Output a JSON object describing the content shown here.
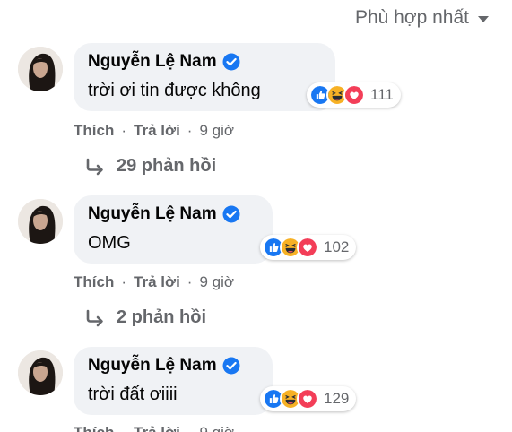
{
  "sort": {
    "label": "Phù hợp nhất"
  },
  "colors": {
    "like_blue": "#1877f2",
    "haha_yellow": "#f7b125",
    "love_red": "#f33e58",
    "muted": "#65676b",
    "bubble": "#f0f2f5"
  },
  "comments": [
    {
      "author": "Nguyễn Lệ Nam",
      "text": "trời ơi tin được không",
      "reaction_icons": [
        "like-icon",
        "haha-icon",
        "love-icon"
      ],
      "reaction_count": "111",
      "actions": {
        "like": "Thích",
        "reply": "Trả lời",
        "time": "9 giờ"
      },
      "replies": "29 phản hồi"
    },
    {
      "author": "Nguyễn Lệ Nam",
      "text": "OMG",
      "reaction_icons": [
        "like-icon",
        "haha-icon",
        "love-icon"
      ],
      "reaction_count": "102",
      "actions": {
        "like": "Thích",
        "reply": "Trả lời",
        "time": "9 giờ"
      },
      "replies": "2 phản hồi"
    },
    {
      "author": "Nguyễn Lệ Nam",
      "text": "trời đất ơiiii",
      "reaction_icons": [
        "like-icon",
        "haha-icon",
        "love-icon"
      ],
      "reaction_count": "129",
      "actions": {
        "like": "Thích",
        "reply": "Trả lời",
        "time": "9 giờ"
      },
      "replies": ""
    }
  ],
  "separator": "·"
}
